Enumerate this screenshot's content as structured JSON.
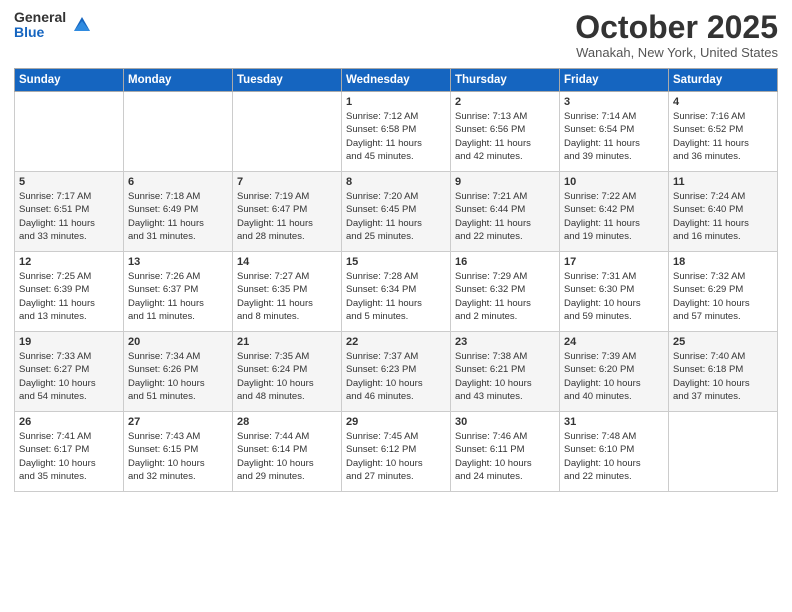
{
  "header": {
    "logo_general": "General",
    "logo_blue": "Blue",
    "title": "October 2025",
    "location": "Wanakah, New York, United States"
  },
  "days_of_week": [
    "Sunday",
    "Monday",
    "Tuesday",
    "Wednesday",
    "Thursday",
    "Friday",
    "Saturday"
  ],
  "weeks": [
    [
      {
        "day": "",
        "info": ""
      },
      {
        "day": "",
        "info": ""
      },
      {
        "day": "",
        "info": ""
      },
      {
        "day": "1",
        "info": "Sunrise: 7:12 AM\nSunset: 6:58 PM\nDaylight: 11 hours\nand 45 minutes."
      },
      {
        "day": "2",
        "info": "Sunrise: 7:13 AM\nSunset: 6:56 PM\nDaylight: 11 hours\nand 42 minutes."
      },
      {
        "day": "3",
        "info": "Sunrise: 7:14 AM\nSunset: 6:54 PM\nDaylight: 11 hours\nand 39 minutes."
      },
      {
        "day": "4",
        "info": "Sunrise: 7:16 AM\nSunset: 6:52 PM\nDaylight: 11 hours\nand 36 minutes."
      }
    ],
    [
      {
        "day": "5",
        "info": "Sunrise: 7:17 AM\nSunset: 6:51 PM\nDaylight: 11 hours\nand 33 minutes."
      },
      {
        "day": "6",
        "info": "Sunrise: 7:18 AM\nSunset: 6:49 PM\nDaylight: 11 hours\nand 31 minutes."
      },
      {
        "day": "7",
        "info": "Sunrise: 7:19 AM\nSunset: 6:47 PM\nDaylight: 11 hours\nand 28 minutes."
      },
      {
        "day": "8",
        "info": "Sunrise: 7:20 AM\nSunset: 6:45 PM\nDaylight: 11 hours\nand 25 minutes."
      },
      {
        "day": "9",
        "info": "Sunrise: 7:21 AM\nSunset: 6:44 PM\nDaylight: 11 hours\nand 22 minutes."
      },
      {
        "day": "10",
        "info": "Sunrise: 7:22 AM\nSunset: 6:42 PM\nDaylight: 11 hours\nand 19 minutes."
      },
      {
        "day": "11",
        "info": "Sunrise: 7:24 AM\nSunset: 6:40 PM\nDaylight: 11 hours\nand 16 minutes."
      }
    ],
    [
      {
        "day": "12",
        "info": "Sunrise: 7:25 AM\nSunset: 6:39 PM\nDaylight: 11 hours\nand 13 minutes."
      },
      {
        "day": "13",
        "info": "Sunrise: 7:26 AM\nSunset: 6:37 PM\nDaylight: 11 hours\nand 11 minutes."
      },
      {
        "day": "14",
        "info": "Sunrise: 7:27 AM\nSunset: 6:35 PM\nDaylight: 11 hours\nand 8 minutes."
      },
      {
        "day": "15",
        "info": "Sunrise: 7:28 AM\nSunset: 6:34 PM\nDaylight: 11 hours\nand 5 minutes."
      },
      {
        "day": "16",
        "info": "Sunrise: 7:29 AM\nSunset: 6:32 PM\nDaylight: 11 hours\nand 2 minutes."
      },
      {
        "day": "17",
        "info": "Sunrise: 7:31 AM\nSunset: 6:30 PM\nDaylight: 10 hours\nand 59 minutes."
      },
      {
        "day": "18",
        "info": "Sunrise: 7:32 AM\nSunset: 6:29 PM\nDaylight: 10 hours\nand 57 minutes."
      }
    ],
    [
      {
        "day": "19",
        "info": "Sunrise: 7:33 AM\nSunset: 6:27 PM\nDaylight: 10 hours\nand 54 minutes."
      },
      {
        "day": "20",
        "info": "Sunrise: 7:34 AM\nSunset: 6:26 PM\nDaylight: 10 hours\nand 51 minutes."
      },
      {
        "day": "21",
        "info": "Sunrise: 7:35 AM\nSunset: 6:24 PM\nDaylight: 10 hours\nand 48 minutes."
      },
      {
        "day": "22",
        "info": "Sunrise: 7:37 AM\nSunset: 6:23 PM\nDaylight: 10 hours\nand 46 minutes."
      },
      {
        "day": "23",
        "info": "Sunrise: 7:38 AM\nSunset: 6:21 PM\nDaylight: 10 hours\nand 43 minutes."
      },
      {
        "day": "24",
        "info": "Sunrise: 7:39 AM\nSunset: 6:20 PM\nDaylight: 10 hours\nand 40 minutes."
      },
      {
        "day": "25",
        "info": "Sunrise: 7:40 AM\nSunset: 6:18 PM\nDaylight: 10 hours\nand 37 minutes."
      }
    ],
    [
      {
        "day": "26",
        "info": "Sunrise: 7:41 AM\nSunset: 6:17 PM\nDaylight: 10 hours\nand 35 minutes."
      },
      {
        "day": "27",
        "info": "Sunrise: 7:43 AM\nSunset: 6:15 PM\nDaylight: 10 hours\nand 32 minutes."
      },
      {
        "day": "28",
        "info": "Sunrise: 7:44 AM\nSunset: 6:14 PM\nDaylight: 10 hours\nand 29 minutes."
      },
      {
        "day": "29",
        "info": "Sunrise: 7:45 AM\nSunset: 6:12 PM\nDaylight: 10 hours\nand 27 minutes."
      },
      {
        "day": "30",
        "info": "Sunrise: 7:46 AM\nSunset: 6:11 PM\nDaylight: 10 hours\nand 24 minutes."
      },
      {
        "day": "31",
        "info": "Sunrise: 7:48 AM\nSunset: 6:10 PM\nDaylight: 10 hours\nand 22 minutes."
      },
      {
        "day": "",
        "info": ""
      }
    ]
  ]
}
